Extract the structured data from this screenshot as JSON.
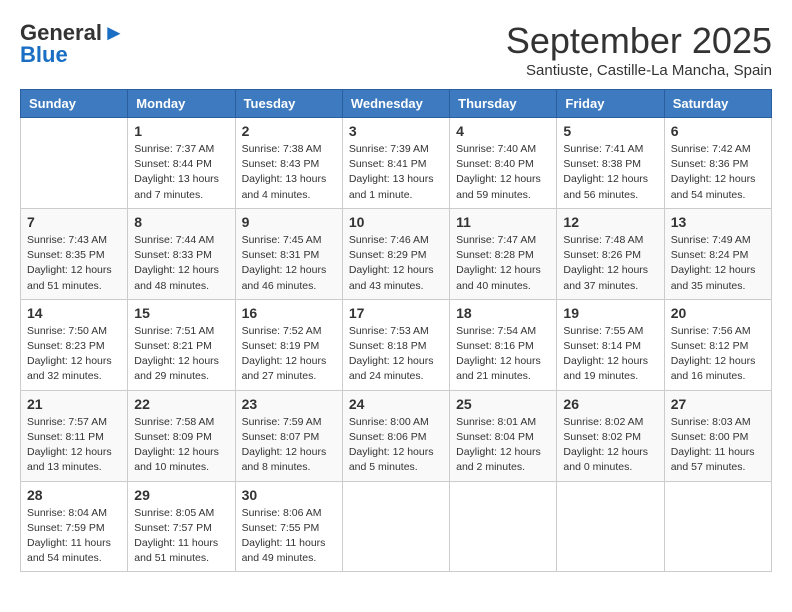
{
  "header": {
    "logo_line1": "General",
    "logo_line2": "Blue",
    "month": "September 2025",
    "location": "Santiuste, Castille-La Mancha, Spain"
  },
  "weekdays": [
    "Sunday",
    "Monday",
    "Tuesday",
    "Wednesday",
    "Thursday",
    "Friday",
    "Saturday"
  ],
  "weeks": [
    [
      {
        "day": "",
        "info": ""
      },
      {
        "day": "1",
        "info": "Sunrise: 7:37 AM\nSunset: 8:44 PM\nDaylight: 13 hours\nand 7 minutes."
      },
      {
        "day": "2",
        "info": "Sunrise: 7:38 AM\nSunset: 8:43 PM\nDaylight: 13 hours\nand 4 minutes."
      },
      {
        "day": "3",
        "info": "Sunrise: 7:39 AM\nSunset: 8:41 PM\nDaylight: 13 hours\nand 1 minute."
      },
      {
        "day": "4",
        "info": "Sunrise: 7:40 AM\nSunset: 8:40 PM\nDaylight: 12 hours\nand 59 minutes."
      },
      {
        "day": "5",
        "info": "Sunrise: 7:41 AM\nSunset: 8:38 PM\nDaylight: 12 hours\nand 56 minutes."
      },
      {
        "day": "6",
        "info": "Sunrise: 7:42 AM\nSunset: 8:36 PM\nDaylight: 12 hours\nand 54 minutes."
      }
    ],
    [
      {
        "day": "7",
        "info": "Sunrise: 7:43 AM\nSunset: 8:35 PM\nDaylight: 12 hours\nand 51 minutes."
      },
      {
        "day": "8",
        "info": "Sunrise: 7:44 AM\nSunset: 8:33 PM\nDaylight: 12 hours\nand 48 minutes."
      },
      {
        "day": "9",
        "info": "Sunrise: 7:45 AM\nSunset: 8:31 PM\nDaylight: 12 hours\nand 46 minutes."
      },
      {
        "day": "10",
        "info": "Sunrise: 7:46 AM\nSunset: 8:29 PM\nDaylight: 12 hours\nand 43 minutes."
      },
      {
        "day": "11",
        "info": "Sunrise: 7:47 AM\nSunset: 8:28 PM\nDaylight: 12 hours\nand 40 minutes."
      },
      {
        "day": "12",
        "info": "Sunrise: 7:48 AM\nSunset: 8:26 PM\nDaylight: 12 hours\nand 37 minutes."
      },
      {
        "day": "13",
        "info": "Sunrise: 7:49 AM\nSunset: 8:24 PM\nDaylight: 12 hours\nand 35 minutes."
      }
    ],
    [
      {
        "day": "14",
        "info": "Sunrise: 7:50 AM\nSunset: 8:23 PM\nDaylight: 12 hours\nand 32 minutes."
      },
      {
        "day": "15",
        "info": "Sunrise: 7:51 AM\nSunset: 8:21 PM\nDaylight: 12 hours\nand 29 minutes."
      },
      {
        "day": "16",
        "info": "Sunrise: 7:52 AM\nSunset: 8:19 PM\nDaylight: 12 hours\nand 27 minutes."
      },
      {
        "day": "17",
        "info": "Sunrise: 7:53 AM\nSunset: 8:18 PM\nDaylight: 12 hours\nand 24 minutes."
      },
      {
        "day": "18",
        "info": "Sunrise: 7:54 AM\nSunset: 8:16 PM\nDaylight: 12 hours\nand 21 minutes."
      },
      {
        "day": "19",
        "info": "Sunrise: 7:55 AM\nSunset: 8:14 PM\nDaylight: 12 hours\nand 19 minutes."
      },
      {
        "day": "20",
        "info": "Sunrise: 7:56 AM\nSunset: 8:12 PM\nDaylight: 12 hours\nand 16 minutes."
      }
    ],
    [
      {
        "day": "21",
        "info": "Sunrise: 7:57 AM\nSunset: 8:11 PM\nDaylight: 12 hours\nand 13 minutes."
      },
      {
        "day": "22",
        "info": "Sunrise: 7:58 AM\nSunset: 8:09 PM\nDaylight: 12 hours\nand 10 minutes."
      },
      {
        "day": "23",
        "info": "Sunrise: 7:59 AM\nSunset: 8:07 PM\nDaylight: 12 hours\nand 8 minutes."
      },
      {
        "day": "24",
        "info": "Sunrise: 8:00 AM\nSunset: 8:06 PM\nDaylight: 12 hours\nand 5 minutes."
      },
      {
        "day": "25",
        "info": "Sunrise: 8:01 AM\nSunset: 8:04 PM\nDaylight: 12 hours\nand 2 minutes."
      },
      {
        "day": "26",
        "info": "Sunrise: 8:02 AM\nSunset: 8:02 PM\nDaylight: 12 hours\nand 0 minutes."
      },
      {
        "day": "27",
        "info": "Sunrise: 8:03 AM\nSunset: 8:00 PM\nDaylight: 11 hours\nand 57 minutes."
      }
    ],
    [
      {
        "day": "28",
        "info": "Sunrise: 8:04 AM\nSunset: 7:59 PM\nDaylight: 11 hours\nand 54 minutes."
      },
      {
        "day": "29",
        "info": "Sunrise: 8:05 AM\nSunset: 7:57 PM\nDaylight: 11 hours\nand 51 minutes."
      },
      {
        "day": "30",
        "info": "Sunrise: 8:06 AM\nSunset: 7:55 PM\nDaylight: 11 hours\nand 49 minutes."
      },
      {
        "day": "",
        "info": ""
      },
      {
        "day": "",
        "info": ""
      },
      {
        "day": "",
        "info": ""
      },
      {
        "day": "",
        "info": ""
      }
    ]
  ]
}
